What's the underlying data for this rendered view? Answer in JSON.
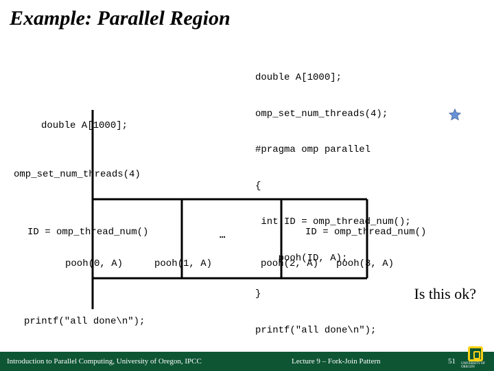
{
  "title": "Example: Parallel Region",
  "code": {
    "l1": "double A[1000];",
    "l2": "omp_set_num_threads(4);",
    "l3": "#pragma omp parallel",
    "l4": "{",
    "l5": " int ID = omp_thread_num();",
    "l6": "    pooh(ID, A);",
    "l7": "}",
    "l8": "printf(\"all done\\n\");"
  },
  "diagram": {
    "decl": "double A[1000];",
    "set": "omp_set_num_threads(4)",
    "idcall_left": "ID = omp_thread_num()",
    "idcall_right": "ID = omp_thread_num()",
    "ellipsis": "…",
    "pooh0": "pooh(0, A)",
    "pooh1": "pooh(1, A)",
    "pooh2": "pooh(2, A)",
    "pooh3": "pooh(3, A)",
    "printf": "printf(\"all done\\n\");"
  },
  "question": "Is this ok?",
  "icons": {
    "star": "star-icon"
  },
  "footer": {
    "left": "Introduction to Parallel Computing, University of Oregon, IPCC",
    "mid": "Lecture 9 – Fork-Join Pattern",
    "page": "51",
    "org": "UNIVERSITY OF OREGON"
  },
  "chart_data": {
    "type": "diagram",
    "description": "Fork-join flow: single thread declares A[1000], sets 4 threads, forks into 4 branches each calling omp_thread_num() then pooh(i,A) for i=0..3, then joins and calls printf.",
    "threads": 4,
    "fork_labels": [
      "pooh(0, A)",
      "pooh(1, A)",
      "pooh(2, A)",
      "pooh(3, A)"
    ]
  }
}
